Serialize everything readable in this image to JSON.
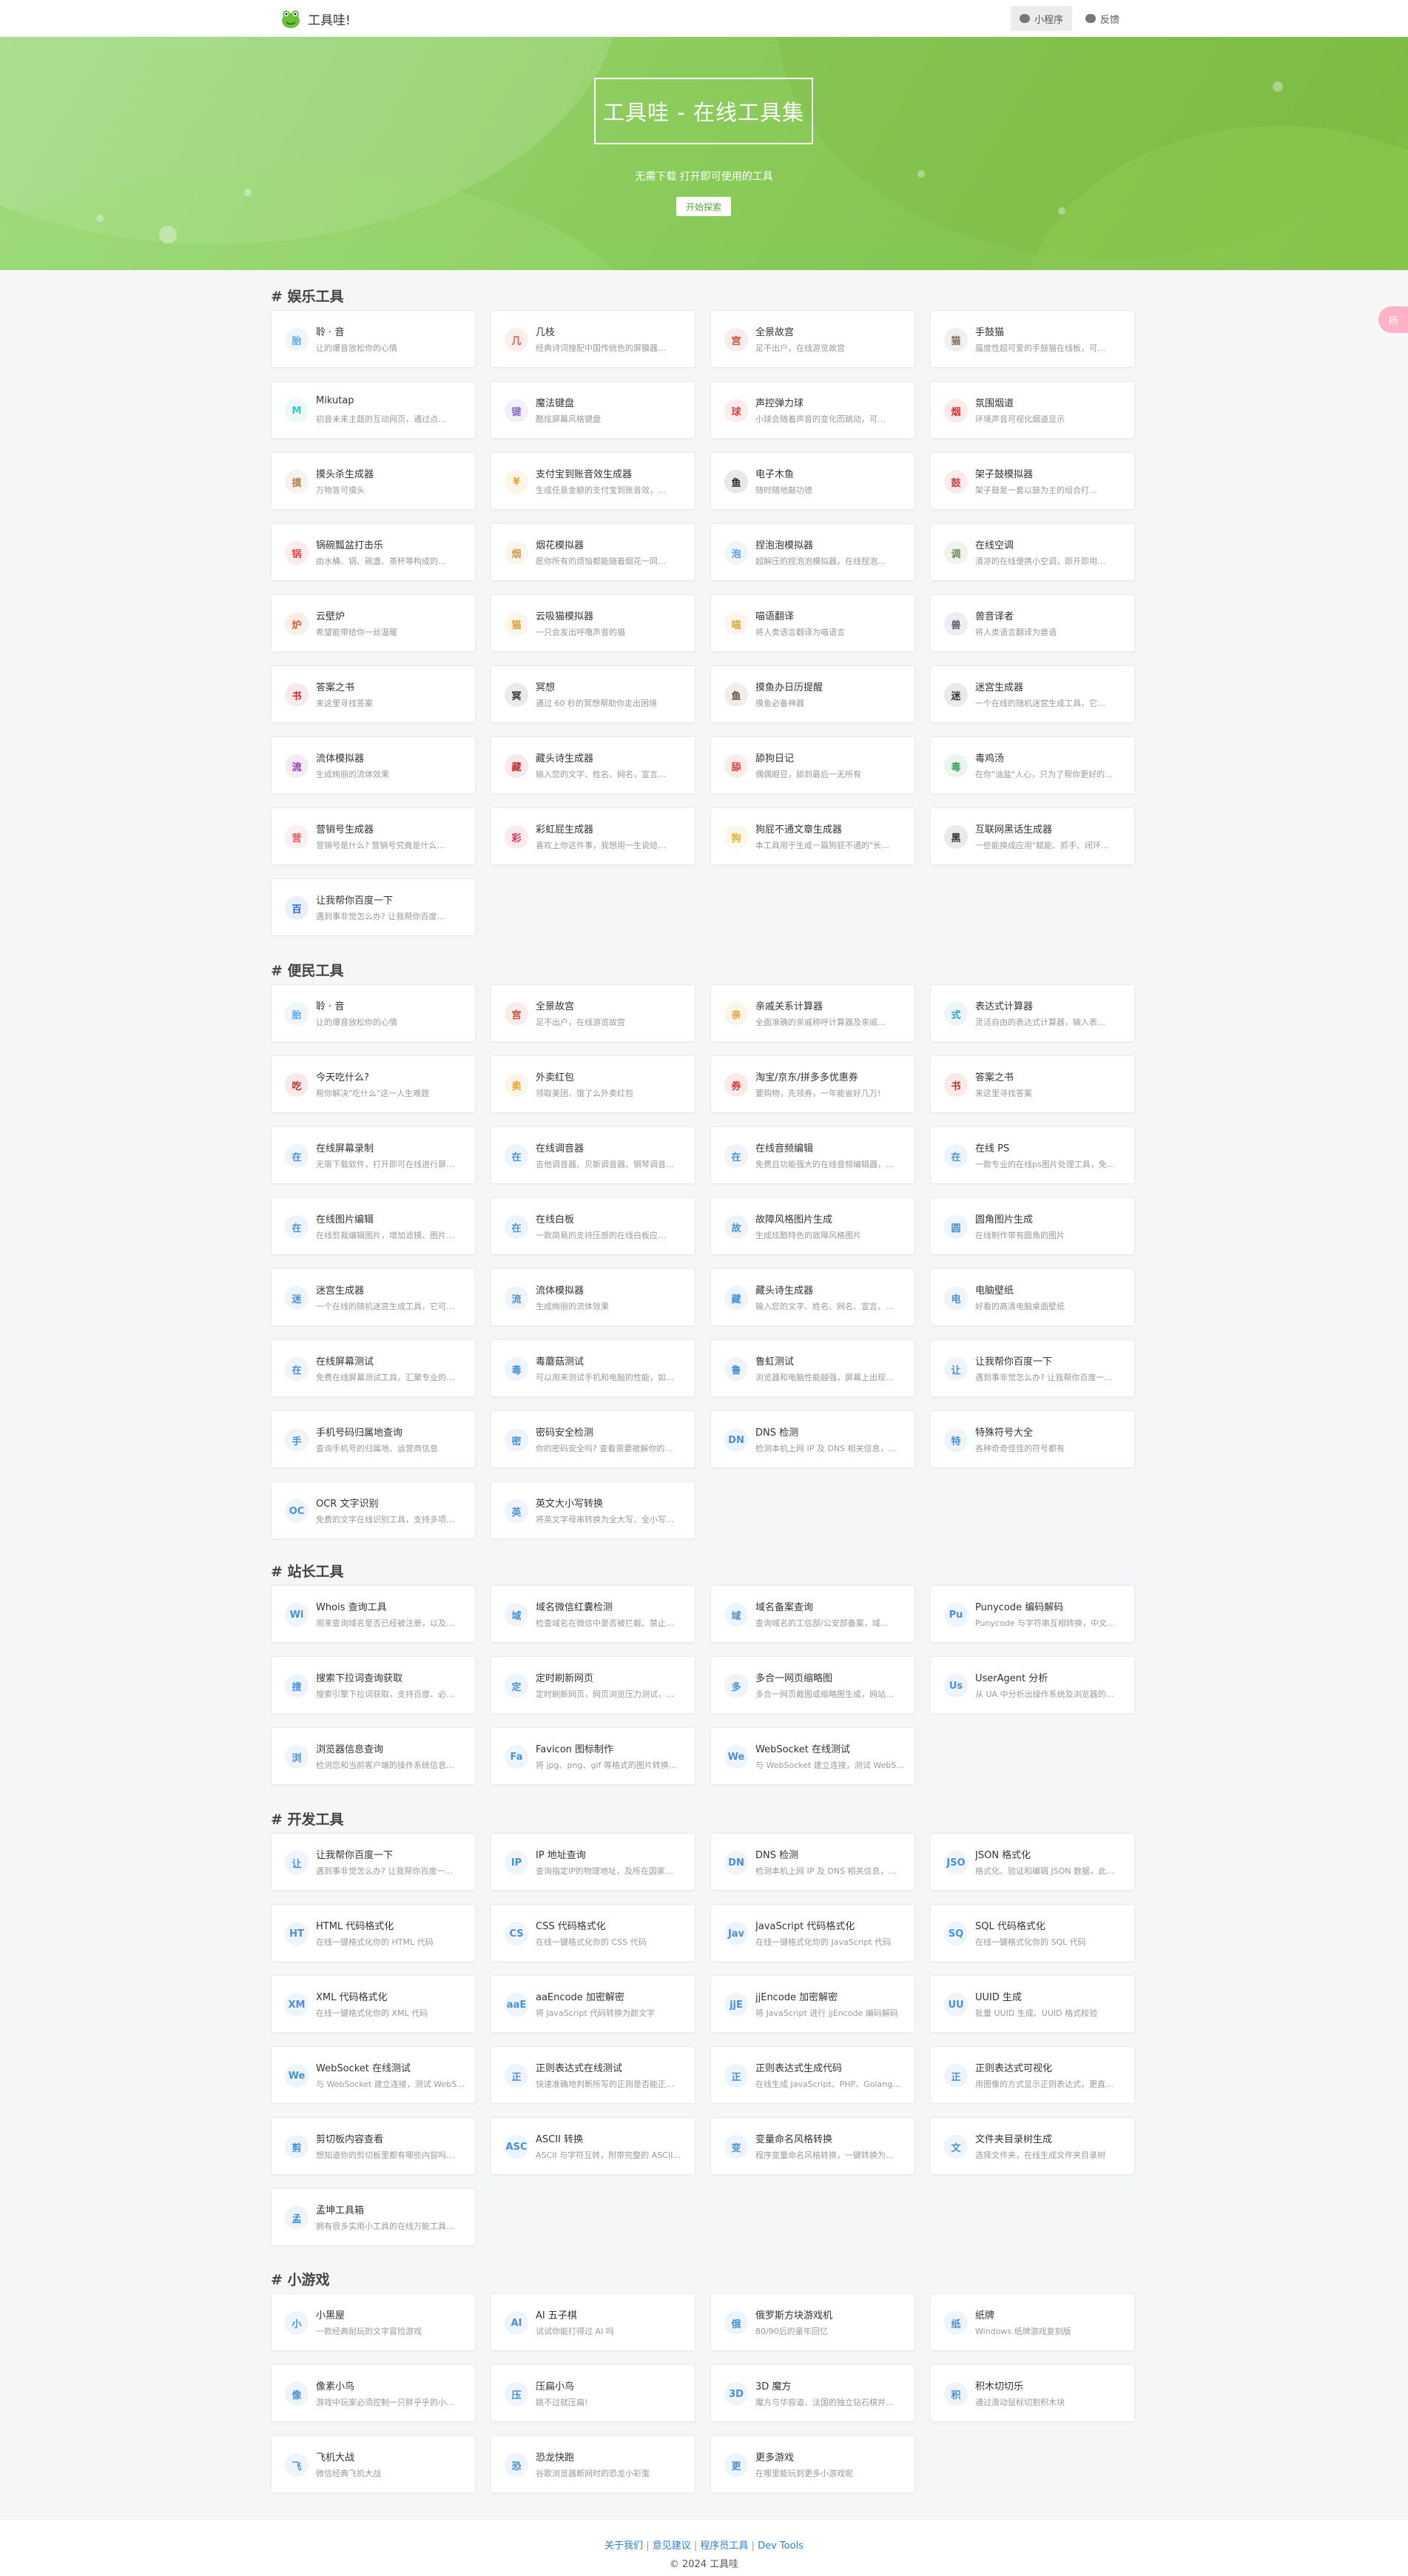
{
  "brand": {
    "title": "工具哇!"
  },
  "nav": {
    "miniprogram": "小程序",
    "feedback": "反馈"
  },
  "hero": {
    "title": "工具哇 - 在线工具集",
    "subtitle": "无需下载 打开即可使用的工具",
    "cta": "开始探索"
  },
  "float_tag": "扬",
  "colors": {
    "accent": "#56a82c",
    "hero_start": "#9edb80",
    "hero_end": "#7dbd43",
    "link": "#2b7fd6"
  },
  "sections": [
    {
      "title": "# 娱乐工具",
      "items": [
        {
          "name": "聆 · 音",
          "desc": "让的爆音放松你的心情",
          "icon": "胎",
          "color": "#5aa9e6"
        },
        {
          "name": "几枝",
          "desc": "经典诗词搜配中国传统色的屏膜器…",
          "icon": "几",
          "color": "#e0564f"
        },
        {
          "name": "全景故宫",
          "desc": "足不出户，在线游览故宫",
          "icon": "宫",
          "color": "#c9503b"
        },
        {
          "name": "手鼓猫",
          "desc": "届度性超可爱的手鼓猫在线板，可…",
          "icon": "猫",
          "color": "#7a6a5a"
        },
        {
          "name": "Mikutap",
          "desc": "初音未来主题的互动网页，通过点…",
          "icon": "M",
          "color": "#39c5bb"
        },
        {
          "name": "魔法键盘",
          "desc": "酷炫屏幕风格键盘",
          "icon": "键",
          "color": "#8a6cc9"
        },
        {
          "name": "声控弹力球",
          "desc": "小球会随着声音的变化而跳动，可…",
          "icon": "球",
          "color": "#e04040"
        },
        {
          "name": "氛围烟道",
          "desc": "环境声音可视化烟道显示",
          "icon": "烟",
          "color": "#e03030"
        },
        {
          "name": "摸头杀生成器",
          "desc": "万物皆可摸头",
          "icon": "摸",
          "color": "#b08050"
        },
        {
          "name": "支付宝到账音效生成器",
          "desc": "生成任意金额的支付宝到账音效，…",
          "icon": "¥",
          "color": "#f0a020"
        },
        {
          "name": "电子木鱼",
          "desc": "随时随地敲功德",
          "icon": "鱼",
          "color": "#222222"
        },
        {
          "name": "架子鼓模拟器",
          "desc": "架子鼓是一套以鼓为主的组合打…",
          "icon": "鼓",
          "color": "#c84040"
        },
        {
          "name": "锅碗瓢盆打击乐",
          "desc": "由水桶、锅、碗盏、茶杯等构成的…",
          "icon": "锅",
          "color": "#e04848"
        },
        {
          "name": "烟花模拟器",
          "desc": "愿你所有的烦恼都能随着烟花一同…",
          "icon": "烟",
          "color": "#c9a040"
        },
        {
          "name": "捏泡泡模拟器",
          "desc": "超解压的捏泡泡模拟器，在线捏泡…",
          "icon": "泡",
          "color": "#5a9be6"
        },
        {
          "name": "在线空调",
          "desc": "清凉的在线便携小空调，即开即用…",
          "icon": "调",
          "color": "#6a8a5a"
        },
        {
          "name": "云壁炉",
          "desc": "希望能带给你一丝温暖",
          "icon": "炉",
          "color": "#e06030"
        },
        {
          "name": "云吸猫模拟器",
          "desc": "一只会发出呼噜声音的猫",
          "icon": "猫",
          "color": "#d8a030"
        },
        {
          "name": "喵语翻译",
          "desc": "将人类语言翻译为喵语言",
          "icon": "喵",
          "color": "#e0a040"
        },
        {
          "name": "兽音译者",
          "desc": "将人类语言翻译为兽语",
          "icon": "兽",
          "color": "#556070"
        },
        {
          "name": "答案之书",
          "desc": "来这里寻找答案",
          "icon": "书",
          "color": "#c03030"
        },
        {
          "name": "冥想",
          "desc": "通过 60 秒的冥想帮助你走出困境",
          "icon": "冥",
          "color": "#333333"
        },
        {
          "name": "摸鱼办日历提醒",
          "desc": "摸鱼必备神器",
          "icon": "鱼",
          "color": "#6a4a3a"
        },
        {
          "name": "迷宫生成器",
          "desc": "一个在线的随机迷宫生成工具，它…",
          "icon": "迷",
          "color": "#333333"
        },
        {
          "name": "流体模拟器",
          "desc": "生成绚丽的流体效果",
          "icon": "流",
          "color": "#8a3ab0"
        },
        {
          "name": "藏头诗生成器",
          "desc": "输入您的文字、姓名、网名，宣言…",
          "icon": "藏",
          "color": "#c03030"
        },
        {
          "name": "舔狗日记",
          "desc": "偶偶眼豆，舔到最后一无所有",
          "icon": "舔",
          "color": "#e04040"
        },
        {
          "name": "毒鸡汤",
          "desc": "在你\"油盐\"人心，只为了帮你更好的…",
          "icon": "毒",
          "color": "#3aa060"
        },
        {
          "name": "营销号生成器",
          "desc": "营销号是什么? 营销号究竟是什么…",
          "icon": "营",
          "color": "#e06060"
        },
        {
          "name": "彩虹屁生成器",
          "desc": "喜欢上你这件事，我想用一生说给…",
          "icon": "彩",
          "color": "#e03060"
        },
        {
          "name": "狗屁不通文章生成器",
          "desc": "本工具用于生成一篇狗屁不通的\"长…",
          "icon": "狗",
          "color": "#e0b020"
        },
        {
          "name": "互联网黑话生成器",
          "desc": "一些能换成应用\"赋能、抓手、闭环…",
          "icon": "黑",
          "color": "#333333"
        },
        {
          "name": "让我帮你百度一下",
          "desc": "遇到事非觉怎么办? 让我帮你百度…",
          "icon": "百",
          "color": "#2a62d8"
        }
      ]
    },
    {
      "title": "# 便民工具",
      "items": [
        {
          "name": "聆 · 音",
          "desc": "让的爆音放松你的心情",
          "icon": "胎",
          "color": "#5aa9e6"
        },
        {
          "name": "全景故宫",
          "desc": "足不出户，在线游览故宫",
          "icon": "宫",
          "color": "#c9503b"
        },
        {
          "name": "亲戚关系计算器",
          "desc": "全面准确的亲戚称呼计算器及亲戚…",
          "icon": "亲",
          "color": "#e0a030"
        },
        {
          "name": "表达式计算器",
          "desc": "灵活自由的表达式计算器，输入表…",
          "icon": "式",
          "color": "#3a9ad0"
        },
        {
          "name": "今天吃什么?",
          "desc": "帮你解决\"吃什么\"这一人生难题",
          "icon": "吃",
          "color": "#c03030"
        },
        {
          "name": "外卖红包",
          "desc": "领取美团、饿了么外卖红包",
          "icon": "卖",
          "color": "#f0a020"
        },
        {
          "name": "淘宝/京东/拼多多优惠券",
          "desc": "要购物，先领券，一年能省好几万!",
          "icon": "券",
          "color": "#e03030"
        },
        {
          "name": "答案之书",
          "desc": "来这里寻找答案",
          "icon": "书",
          "color": "#c03030"
        },
        {
          "name": "在线屏幕录制",
          "desc": "无需下载软件，打开即可在线进行屏…",
          "icon": "在",
          "color": "#4a90d9"
        },
        {
          "name": "在线调音器",
          "desc": "吉他调音器、贝斯调音器、钢琴调音…",
          "icon": "在",
          "color": "#4a90d9"
        },
        {
          "name": "在线音频编辑",
          "desc": "免费且功能强大的在线音频编辑器，…",
          "icon": "在",
          "color": "#4a90d9"
        },
        {
          "name": "在线 PS",
          "desc": "一款专业的在线ps图片处理工具，免…",
          "icon": "在",
          "color": "#4a90d9"
        },
        {
          "name": "在线图片编辑",
          "desc": "在线剪裁编辑图片，增加滤镜、图片…",
          "icon": "在",
          "color": "#4a90d9"
        },
        {
          "name": "在线白板",
          "desc": "一款简易的支持压感的在线白板应…",
          "icon": "在",
          "color": "#4a90d9"
        },
        {
          "name": "故障风格图片生成",
          "desc": "生成炫酷特色的故障风格图片",
          "icon": "故",
          "color": "#4a90d9"
        },
        {
          "name": "圆角图片生成",
          "desc": "在线制作带有圆角的图片",
          "icon": "圆",
          "color": "#4a90d9"
        },
        {
          "name": "迷宫生成器",
          "desc": "一个在线的随机迷宫生成工具，它可…",
          "icon": "迷",
          "color": "#4a90d9"
        },
        {
          "name": "流体模拟器",
          "desc": "生成绚丽的流体效果",
          "icon": "流",
          "color": "#4a90d9"
        },
        {
          "name": "藏头诗生成器",
          "desc": "输入您的文字、姓名、网名、宣言、…",
          "icon": "藏",
          "color": "#4a90d9"
        },
        {
          "name": "电脑壁纸",
          "desc": "好看的高清电脑桌面壁纸",
          "icon": "电",
          "color": "#4a90d9"
        },
        {
          "name": "在线屏幕测试",
          "desc": "免费在线屏幕测试工具，汇聚专业的…",
          "icon": "在",
          "color": "#4a90d9"
        },
        {
          "name": "毒蘑菇测试",
          "desc": "可以用来测试手机和电脑的性能，如…",
          "icon": "毒",
          "color": "#4a90d9"
        },
        {
          "name": "鲁虹测试",
          "desc": "浏览器和电脑性能越强，屏幕上出现…",
          "icon": "鲁",
          "color": "#4a90d9"
        },
        {
          "name": "让我帮你百度一下",
          "desc": "遇到事非觉怎么办? 让我帮你百度一…",
          "icon": "让",
          "color": "#4a90d9"
        },
        {
          "name": "手机号码归属地查询",
          "desc": "查询手机号的归属地、运营商信息",
          "icon": "手",
          "color": "#4a90d9"
        },
        {
          "name": "密码安全检测",
          "desc": "你的密码安全吗? 查看需要被解你的…",
          "icon": "密",
          "color": "#4a90d9"
        },
        {
          "name": "DNS 检测",
          "desc": "检测本机上网 IP 及 DNS 相关信息，…",
          "icon": "DN",
          "color": "#4a90d9"
        },
        {
          "name": "特殊符号大全",
          "desc": "各种奇奇怪怪的符号都有",
          "icon": "特",
          "color": "#4a90d9"
        },
        {
          "name": "OCR 文字识别",
          "desc": "免费的文字在线识别工具，支持多项…",
          "icon": "OC",
          "color": "#4a90d9"
        },
        {
          "name": "英文大小写转换",
          "desc": "将英文字母串转换为全大写、全小写…",
          "icon": "英",
          "color": "#4a90d9"
        }
      ]
    },
    {
      "title": "# 站长工具",
      "items": [
        {
          "name": "Whois 查询工具",
          "desc": "用来查询域名是否已经被注册，以及…",
          "icon": "Wi",
          "color": "#4a90d9"
        },
        {
          "name": "域名微信红囊检测",
          "desc": "检查域名在微信中是否被拦截、禁止…",
          "icon": "域",
          "color": "#4a90d9"
        },
        {
          "name": "域名备案查询",
          "desc": "查询域名的工信部/公安部备案，域…",
          "icon": "域",
          "color": "#4a90d9"
        },
        {
          "name": "Punycode 编码解码",
          "desc": "Punycode 与字符串互相转换，中文…",
          "icon": "Pu",
          "color": "#4a90d9"
        },
        {
          "name": "搜索下拉词查询获取",
          "desc": "搜索引擎下拉词获取，支持百度、必…",
          "icon": "搜",
          "color": "#4a90d9"
        },
        {
          "name": "定时刷新网页",
          "desc": "定时刷新网页，网页浏览压力测试，…",
          "icon": "定",
          "color": "#4a90d9"
        },
        {
          "name": "多合一网页缩略图",
          "desc": "多合一网页截图或缩略图生成，网站…",
          "icon": "多",
          "color": "#4a90d9"
        },
        {
          "name": "UserAgent 分析",
          "desc": "从 UA 中分析出操作系统及浏览器的…",
          "icon": "Us",
          "color": "#4a90d9"
        },
        {
          "name": "浏览器信息查询",
          "desc": "检测您和当前客户端的操作系统信息…",
          "icon": "浏",
          "color": "#4a90d9"
        },
        {
          "name": "Favicon 图标制作",
          "desc": "将 jpg、png、gif 等格式的图片转换…",
          "icon": "Fa",
          "color": "#4a90d9"
        },
        {
          "name": "WebSocket 在线测试",
          "desc": "与 WebSocket 建立连接，测试 WebS…",
          "icon": "We",
          "color": "#4a90d9"
        }
      ]
    },
    {
      "title": "# 开发工具",
      "items": [
        {
          "name": "让我帮你百度一下",
          "desc": "遇到事非觉怎么办? 让我帮你百度一…",
          "icon": "让",
          "color": "#4a90d9"
        },
        {
          "name": "IP 地址查询",
          "desc": "查询指定IP的物理地址，及所在国家…",
          "icon": "IP",
          "color": "#4a90d9"
        },
        {
          "name": "DNS 检测",
          "desc": "检测本机上网 IP 及 DNS 相关信息，…",
          "icon": "DN",
          "color": "#4a90d9"
        },
        {
          "name": "JSON 格式化",
          "desc": "格式化、验证和编辑 JSON 数据，此…",
          "icon": "JSO",
          "color": "#4a90d9"
        },
        {
          "name": "HTML 代码格式化",
          "desc": "在线一键格式化你的 HTML 代码",
          "icon": "HT",
          "color": "#4a90d9"
        },
        {
          "name": "CSS 代码格式化",
          "desc": "在线一键格式化你的 CSS 代码",
          "icon": "CS",
          "color": "#4a90d9"
        },
        {
          "name": "JavaScript 代码格式化",
          "desc": "在线一键格式化你的 JavaScript 代码",
          "icon": "Jav",
          "color": "#4a90d9"
        },
        {
          "name": "SQL 代码格式化",
          "desc": "在线一键格式化你的 SQL 代码",
          "icon": "SQ",
          "color": "#4a90d9"
        },
        {
          "name": "XML 代码格式化",
          "desc": "在线一键格式化你的 XML 代码",
          "icon": "XM",
          "color": "#4a90d9"
        },
        {
          "name": "aaEncode 加密解密",
          "desc": "将 JavaScript 代码转换为颜文字",
          "icon": "aaE",
          "color": "#4a90d9"
        },
        {
          "name": "jjEncode 加密解密",
          "desc": "将 JavaScript 进行 jjEncode 编码解码",
          "icon": "jjE",
          "color": "#4a90d9"
        },
        {
          "name": "UUID 生成",
          "desc": "批量 UUID 生成、UUID 格式校验",
          "icon": "UU",
          "color": "#4a90d9"
        },
        {
          "name": "WebSocket 在线测试",
          "desc": "与 WebSocket 建立连接，测试 WebS…",
          "icon": "We",
          "color": "#4a90d9"
        },
        {
          "name": "正则表达式在线测试",
          "desc": "快速准确地判断所写的正则是否能正…",
          "icon": "正",
          "color": "#4a90d9"
        },
        {
          "name": "正则表达式生成代码",
          "desc": "在线生成 JavaScript、PHP、Golang…",
          "icon": "正",
          "color": "#4a90d9"
        },
        {
          "name": "正则表达式可视化",
          "desc": "用图像的方式显示正则表达式，更直…",
          "icon": "正",
          "color": "#4a90d9"
        },
        {
          "name": "剪切板内容查看",
          "desc": "想知道你的剪切板里都有哪些内容吗…",
          "icon": "剪",
          "color": "#4a90d9"
        },
        {
          "name": "ASCII 转换",
          "desc": "ASCII 与字符互转，附带完整的 ASCII…",
          "icon": "ASC",
          "color": "#4a90d9"
        },
        {
          "name": "变量命名风格转换",
          "desc": "程序变量命名风格转换，一键转换为…",
          "icon": "变",
          "color": "#4a90d9"
        },
        {
          "name": "文件夹目录树生成",
          "desc": "选择文件夹，在线生成文件夹目录树",
          "icon": "文",
          "color": "#4a90d9"
        },
        {
          "name": "孟坤工具箱",
          "desc": "拥有很多实用小工具的在线万能工具…",
          "icon": "孟",
          "color": "#4a90d9"
        }
      ]
    },
    {
      "title": "# 小游戏",
      "items": [
        {
          "name": "小黑屋",
          "desc": "一款经典耐玩的文字冒险游戏",
          "icon": "小",
          "color": "#4a90d9"
        },
        {
          "name": "AI 五子棋",
          "desc": "试试你能打得过 AI 吗",
          "icon": "AI",
          "color": "#4a90d9"
        },
        {
          "name": "俄罗斯方块游戏机",
          "desc": "80/90后的童年回忆",
          "icon": "俄",
          "color": "#4a90d9"
        },
        {
          "name": "纸牌",
          "desc": "Windows 纸牌游戏复刻版",
          "icon": "纸",
          "color": "#4a90d9"
        },
        {
          "name": "像素小鸟",
          "desc": "游戏中玩家必须控制一只胖乎乎的小…",
          "icon": "像",
          "color": "#4a90d9"
        },
        {
          "name": "压扁小鸟",
          "desc": "跳不过就压扁!",
          "icon": "压",
          "color": "#4a90d9"
        },
        {
          "name": "3D 魔方",
          "desc": "魔方与华容道、法国的独立钻石棋并…",
          "icon": "3D",
          "color": "#4a90d9"
        },
        {
          "name": "积木切切乐",
          "desc": "通过滑动鼠标切割积木块",
          "icon": "积",
          "color": "#4a90d9"
        },
        {
          "name": "飞机大战",
          "desc": "微信经典飞机大战",
          "icon": "飞",
          "color": "#4a90d9"
        },
        {
          "name": "恐龙快跑",
          "desc": "谷歌浏览器断网时的恐龙小彩蛋",
          "icon": "恐",
          "color": "#4a90d9"
        },
        {
          "name": "更多游戏",
          "desc": "在哪里能玩到更多小游戏呢",
          "icon": "更",
          "color": "#4a90d9"
        }
      ]
    }
  ],
  "footer": {
    "links": [
      "关于我们",
      "意见建议",
      "程序员工具",
      "Dev Tools"
    ],
    "separator": "|",
    "copyright": "© 2024 工具哇"
  }
}
